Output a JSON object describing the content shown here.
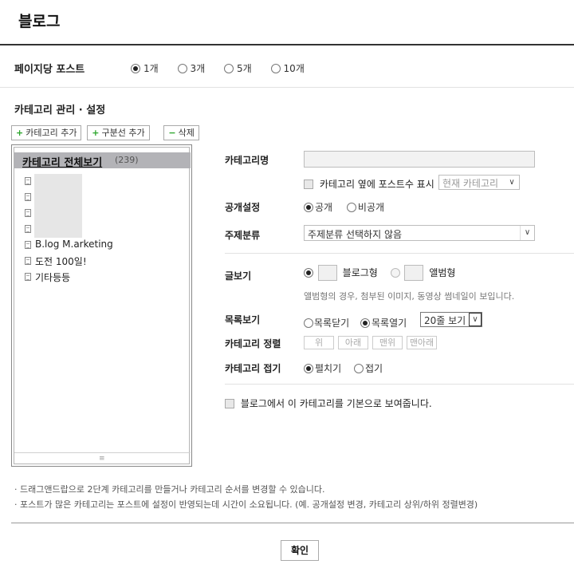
{
  "page": {
    "title": "블로그"
  },
  "posts_per_page": {
    "label": "페이지당 포스트",
    "options": [
      "1개",
      "3개",
      "5개",
      "10개"
    ],
    "selected": "1개"
  },
  "category_section": {
    "label": "카테고리 관리 · 설정",
    "buttons": {
      "add_category": "카테고리 추가",
      "add_divider": "구분선 추가",
      "delete": "삭제"
    }
  },
  "tree": {
    "all_label": "카테고리 전체보기",
    "all_count": "(239)",
    "items": [
      "B.log M.arketing",
      "도전 100일!",
      "기타등등"
    ]
  },
  "form": {
    "category_name_label": "카테고리명",
    "category_name_value": "",
    "show_count_label": "카테고리 옆에 포스트수 표시",
    "show_count_select": "현재 카테고리",
    "visibility_label": "공개설정",
    "visibility_options": [
      "공개",
      "비공개"
    ],
    "visibility_selected": "공개",
    "topic_label": "주제분류",
    "topic_value": "주제분류 선택하지 않음",
    "view_label": "글보기",
    "view_options": [
      "블로그형",
      "앨범형"
    ],
    "view_selected": "블로그형",
    "view_note": "앨범형의 경우, 첨부된 이미지, 동영상 썸네일이 보입니다.",
    "list_label": "목록보기",
    "list_options": [
      "목록닫기",
      "목록열기"
    ],
    "list_selected": "목록열기",
    "list_rows_value": "20줄 보기",
    "sort_label": "카테고리 정렬",
    "sort_buttons": [
      "위",
      "아래",
      "맨위",
      "맨아래"
    ],
    "fold_label": "카테고리 접기",
    "fold_options": [
      "펼치기",
      "접기"
    ],
    "fold_selected": "펼치기",
    "default_label": "블로그에서 이 카테고리를 기본으로 보여줍니다."
  },
  "notes": [
    "· 드래그앤드랍으로 2단계 카테고리를 만들거나 카테고리 순서를 변경할 수 있습니다.",
    "· 포스트가 많은 카테고리는 포스트에 설정이 반영되는데 시간이 소요됩니다. (예. 공개설정 변경, 카테고리 상위/하위 정렬변경)"
  ],
  "confirm_label": "확인",
  "icons": [
    "plus-icon",
    "minus-icon",
    "document-icon",
    "dropdown-arrow-icon",
    "drag-handle-icon",
    "blog-view-icon",
    "album-view-icon"
  ]
}
